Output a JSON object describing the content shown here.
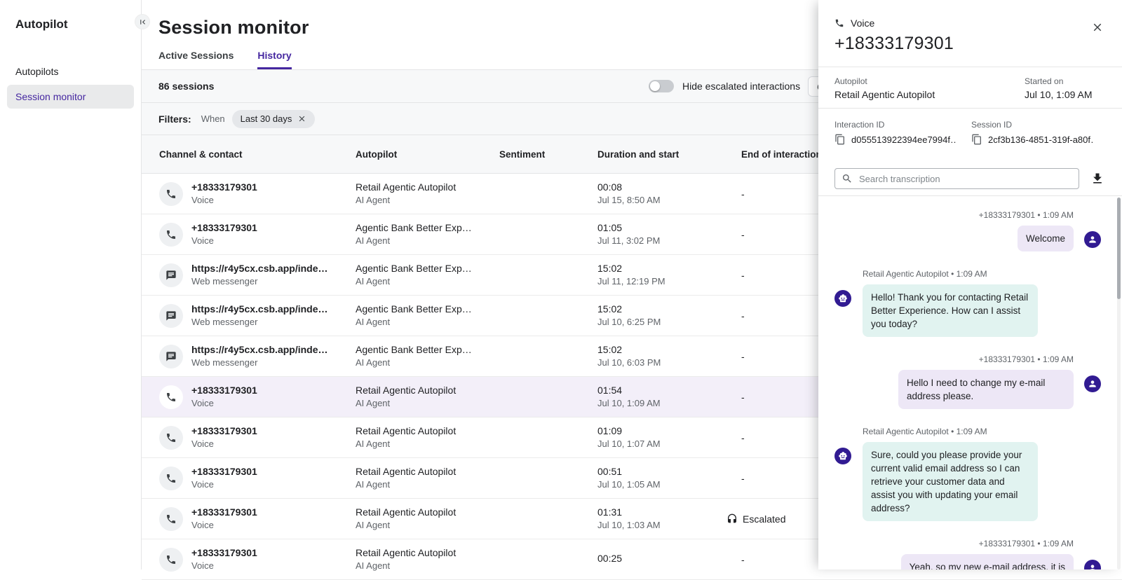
{
  "colors": {
    "accent_purple": "#4527a0",
    "avatar_purple": "#311b92",
    "bot_bubble": "#e1f3f0",
    "user_bubble": "#ede7f6",
    "selected_row": "#f3eff9"
  },
  "sidebar": {
    "title": "Autopilot",
    "items": [
      {
        "label": "Autopilots",
        "selected": false
      },
      {
        "label": "Session monitor",
        "selected": true
      }
    ]
  },
  "header": {
    "title": "Session monitor",
    "tabs": [
      {
        "label": "Active Sessions",
        "active": false
      },
      {
        "label": "History",
        "active": true
      }
    ]
  },
  "toolbar": {
    "sessions_count": "86 sessions",
    "toggle_label": "Hide escalated interactions",
    "toggle_state": "off",
    "cut_button_label": "C"
  },
  "filters": {
    "label": "Filters:",
    "when_label": "When",
    "chip_value": "Last 30 days"
  },
  "table": {
    "columns": [
      "Channel & contact",
      "Autopilot",
      "Sentiment",
      "Duration and start",
      "End of interaction"
    ],
    "rows": [
      {
        "channel_icon": "phone",
        "contact": "+18333179301",
        "channel": "Voice",
        "autopilot": "Retail Agentic Autopilot",
        "agent_type": "AI Agent",
        "sentiment": "",
        "duration": "00:08",
        "start": "Jul 15, 8:50 AM",
        "end": "-",
        "selected": false
      },
      {
        "channel_icon": "phone",
        "contact": "+18333179301",
        "channel": "Voice",
        "autopilot": "Agentic Bank Better Exp…",
        "agent_type": "AI Agent",
        "sentiment": "",
        "duration": "01:05",
        "start": "Jul 11, 3:02 PM",
        "end": "-",
        "selected": false
      },
      {
        "channel_icon": "chat",
        "contact": "https://r4y5cx.csb.app/inde…",
        "channel": "Web messenger",
        "autopilot": "Agentic Bank Better Exp…",
        "agent_type": "AI Agent",
        "sentiment": "",
        "duration": "15:02",
        "start": "Jul 11, 12:19 PM",
        "end": "-",
        "selected": false
      },
      {
        "channel_icon": "chat",
        "contact": "https://r4y5cx.csb.app/inde…",
        "channel": "Web messenger",
        "autopilot": "Agentic Bank Better Exp…",
        "agent_type": "AI Agent",
        "sentiment": "",
        "duration": "15:02",
        "start": "Jul 10, 6:25 PM",
        "end": "-",
        "selected": false
      },
      {
        "channel_icon": "chat",
        "contact": "https://r4y5cx.csb.app/inde…",
        "channel": "Web messenger",
        "autopilot": "Agentic Bank Better Exp…",
        "agent_type": "AI Agent",
        "sentiment": "",
        "duration": "15:02",
        "start": "Jul 10, 6:03 PM",
        "end": "-",
        "selected": false
      },
      {
        "channel_icon": "phone",
        "contact": "+18333179301",
        "channel": "Voice",
        "autopilot": "Retail Agentic Autopilot",
        "agent_type": "AI Agent",
        "sentiment": "",
        "duration": "01:54",
        "start": "Jul 10, 1:09 AM",
        "end": "-",
        "selected": true
      },
      {
        "channel_icon": "phone",
        "contact": "+18333179301",
        "channel": "Voice",
        "autopilot": "Retail Agentic Autopilot",
        "agent_type": "AI Agent",
        "sentiment": "",
        "duration": "01:09",
        "start": "Jul 10, 1:07 AM",
        "end": "-",
        "selected": false
      },
      {
        "channel_icon": "phone",
        "contact": "+18333179301",
        "channel": "Voice",
        "autopilot": "Retail Agentic Autopilot",
        "agent_type": "AI Agent",
        "sentiment": "",
        "duration": "00:51",
        "start": "Jul 10, 1:05 AM",
        "end": "-",
        "selected": false
      },
      {
        "channel_icon": "phone",
        "contact": "+18333179301",
        "channel": "Voice",
        "autopilot": "Retail Agentic Autopilot",
        "agent_type": "AI Agent",
        "sentiment": "",
        "duration": "01:31",
        "start": "Jul 10, 1:03 AM",
        "end": "Escalated",
        "selected": false
      },
      {
        "channel_icon": "phone",
        "contact": "+18333179301",
        "channel": "Voice",
        "autopilot": "Retail Agentic Autopilot",
        "agent_type": "AI Agent",
        "sentiment": "",
        "duration": "00:25",
        "start": "",
        "end": "-",
        "selected": false
      }
    ]
  },
  "panel": {
    "channel_label": "Voice",
    "title": "+18333179301",
    "autopilot_label": "Autopilot",
    "autopilot_value": "Retail Agentic Autopilot",
    "started_label": "Started on",
    "started_value": "Jul 10, 1:09 AM",
    "interaction_id_label": "Interaction ID",
    "interaction_id_value": "d055513922394ee7994f…",
    "session_id_label": "Session ID",
    "session_id_value": "2cf3b136-4851-319f-a80f…",
    "search_placeholder": "Search transcription",
    "messages": [
      {
        "side": "user",
        "meta": "+18333179301 • 1:09 AM",
        "text": "Welcome"
      },
      {
        "side": "bot",
        "meta": "Retail Agentic Autopilot • 1:09 AM",
        "text": "Hello! Thank you for contacting Retail Better Experience. How can I assist you today?"
      },
      {
        "side": "user",
        "meta": "+18333179301 • 1:09 AM",
        "text": "Hello I need to change my e-mail address please."
      },
      {
        "side": "bot",
        "meta": "Retail Agentic Autopilot • 1:09 AM",
        "text": "Sure, could you please provide your current valid email address so I can retrieve your customer data and assist you with updating your email address?"
      },
      {
        "side": "user",
        "meta": "+18333179301 • 1:09 AM",
        "text": "Yeah, so my new e-mail address, it is"
      }
    ]
  }
}
